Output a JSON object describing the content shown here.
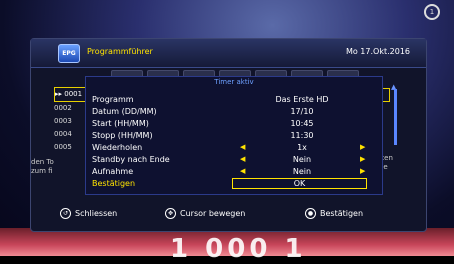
{
  "guide": {
    "title": "Programmführer",
    "date": "Mo 17.Okt.2016",
    "logo": "EPG",
    "list": [
      "0001",
      "0002",
      "0003",
      "0004",
      "0005"
    ],
    "desc_left": [
      "den To",
      "zum fi"
    ],
    "desc_right": [
      "uten",
      "die"
    ]
  },
  "dialog": {
    "title": "Timer aktiv",
    "rows": [
      {
        "label": "Programm",
        "value": "Das Erste HD"
      },
      {
        "label": "Datum (DD/MM)",
        "value": "17/10"
      },
      {
        "label": "Start (HH/MM)",
        "value": "10:45"
      },
      {
        "label": "Stopp (HH/MM)",
        "value": "11:30"
      },
      {
        "label": "Wiederholen",
        "value": "1x"
      },
      {
        "label": "Standby nach Ende",
        "value": "Nein"
      },
      {
        "label": "Aufnahme",
        "value": "Nein"
      }
    ],
    "confirm_label": "Bestätigen",
    "ok": "OK"
  },
  "footer": {
    "close": "Schliessen",
    "move": "Cursor bewegen",
    "confirm": "Bestätigen"
  },
  "tv_number": "1 000 1"
}
